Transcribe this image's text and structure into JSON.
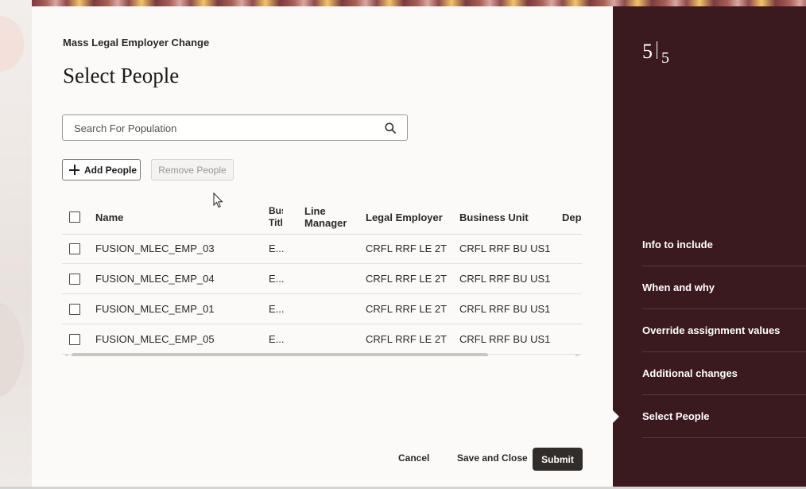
{
  "header": {
    "breadcrumb": "Mass Legal Employer Change",
    "title": "Select People"
  },
  "search": {
    "placeholder": "Search For Population",
    "value": ""
  },
  "actions": {
    "add_label": "Add People",
    "remove_label": "Remove People"
  },
  "table": {
    "columns": [
      "Name",
      "Bus Titl",
      "Line Manager",
      "Legal Employer",
      "Business Unit",
      "Depa"
    ],
    "column_headers": {
      "name": "Name",
      "bus_title_line1": "Bus",
      "bus_title_line2": "Titl",
      "line_manager_line1": "Line",
      "line_manager_line2": "Manager",
      "legal_employer": "Legal Employer",
      "business_unit": "Business Unit",
      "department": "Depa"
    },
    "rows": [
      {
        "name": "FUSION_MLEC_EMP_03",
        "bus_title": "E...",
        "line_manager": "",
        "legal_employer": "CRFL RRF LE 2T",
        "business_unit": "CRFL RRF BU US1",
        "department": ""
      },
      {
        "name": "FUSION_MLEC_EMP_04",
        "bus_title": "E...",
        "line_manager": "",
        "legal_employer": "CRFL RRF LE 2T",
        "business_unit": "CRFL RRF BU US1",
        "department": ""
      },
      {
        "name": "FUSION_MLEC_EMP_01",
        "bus_title": "E...",
        "line_manager": "",
        "legal_employer": "CRFL RRF LE 2T",
        "business_unit": "CRFL RRF BU US1",
        "department": ""
      },
      {
        "name": "FUSION_MLEC_EMP_05",
        "bus_title": "E...",
        "line_manager": "",
        "legal_employer": "CRFL RRF LE 2T",
        "business_unit": "CRFL RRF BU US1",
        "department": ""
      }
    ]
  },
  "footer": {
    "cancel_label": "Cancel",
    "save_close_label": "Save and Close",
    "submit_label": "Submit"
  },
  "train": {
    "current_step": "5",
    "total_steps": "5",
    "steps": [
      {
        "label": "Info to include"
      },
      {
        "label": "When and why"
      },
      {
        "label": "Override assignment values"
      },
      {
        "label": "Additional changes"
      },
      {
        "label": "Select People",
        "active": true
      }
    ]
  },
  "icons": {
    "search": "search-icon",
    "add": "plus-icon",
    "cursor": "mouse-cursor-icon"
  },
  "colors": {
    "train_background": "#3b1a1f",
    "primary_button": "#312d2a",
    "page_background": "#fbfaf8"
  }
}
